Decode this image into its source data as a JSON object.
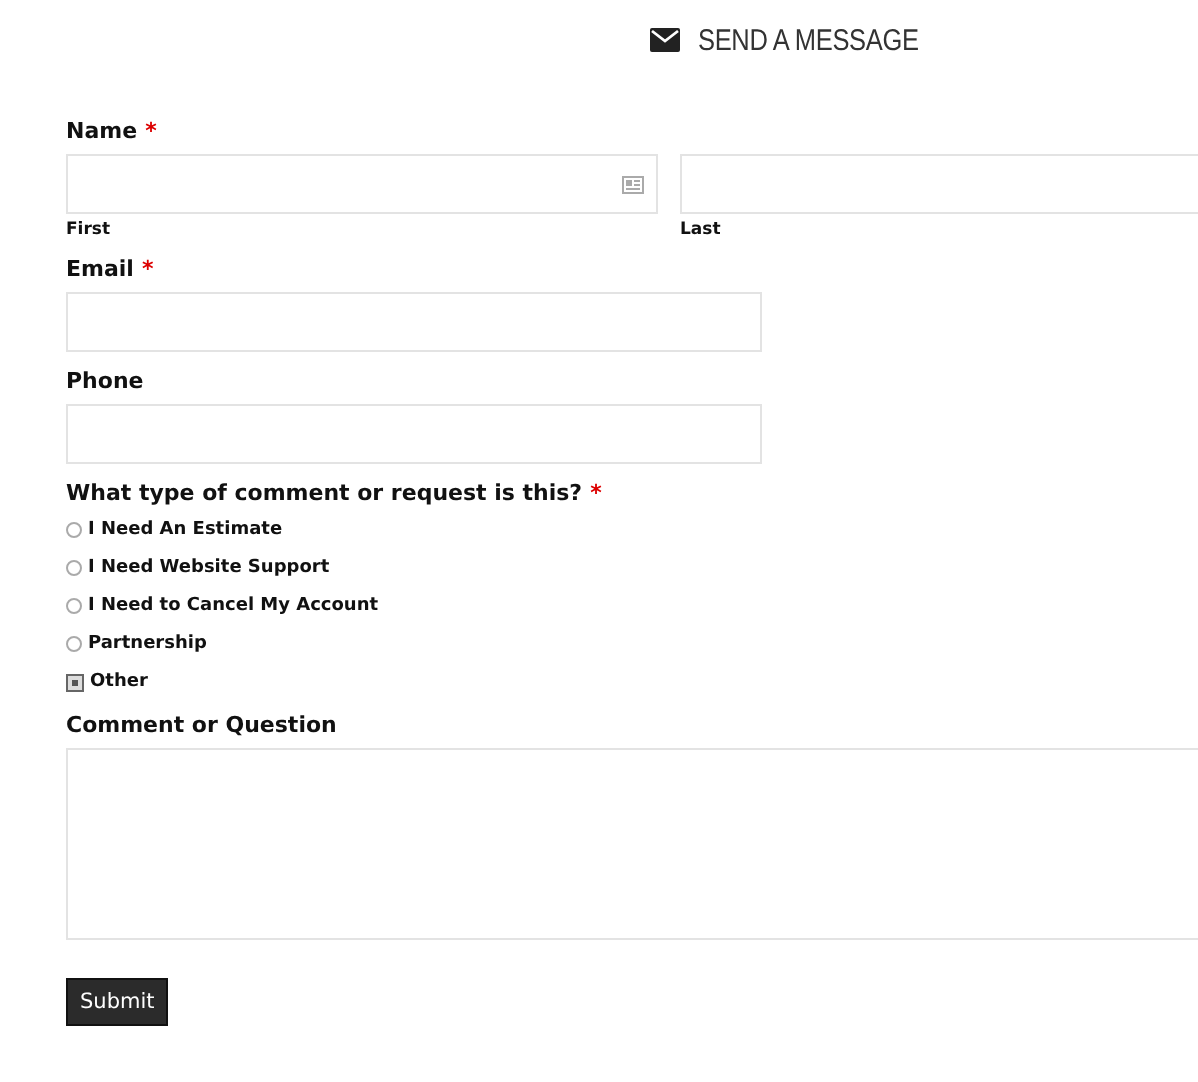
{
  "heading": "SEND A MESSAGE",
  "name": {
    "label": "Name",
    "required_mark": "*",
    "sublabels": [
      "First",
      "Last"
    ]
  },
  "email": {
    "label": "Email",
    "required_mark": "*"
  },
  "phone": {
    "label": "Phone"
  },
  "request": {
    "label": "What type of comment or request is this?",
    "required_mark": "*",
    "options": [
      {
        "label": "I Need An Estimate",
        "selected": false
      },
      {
        "label": "I Need Website Support",
        "selected": false
      },
      {
        "label": "I Need to Cancel My Account",
        "selected": false
      },
      {
        "label": "Partnership",
        "selected": false
      },
      {
        "label": "Other",
        "selected": true
      }
    ]
  },
  "comment": {
    "label": "Comment or Question"
  },
  "submit": "Submit"
}
